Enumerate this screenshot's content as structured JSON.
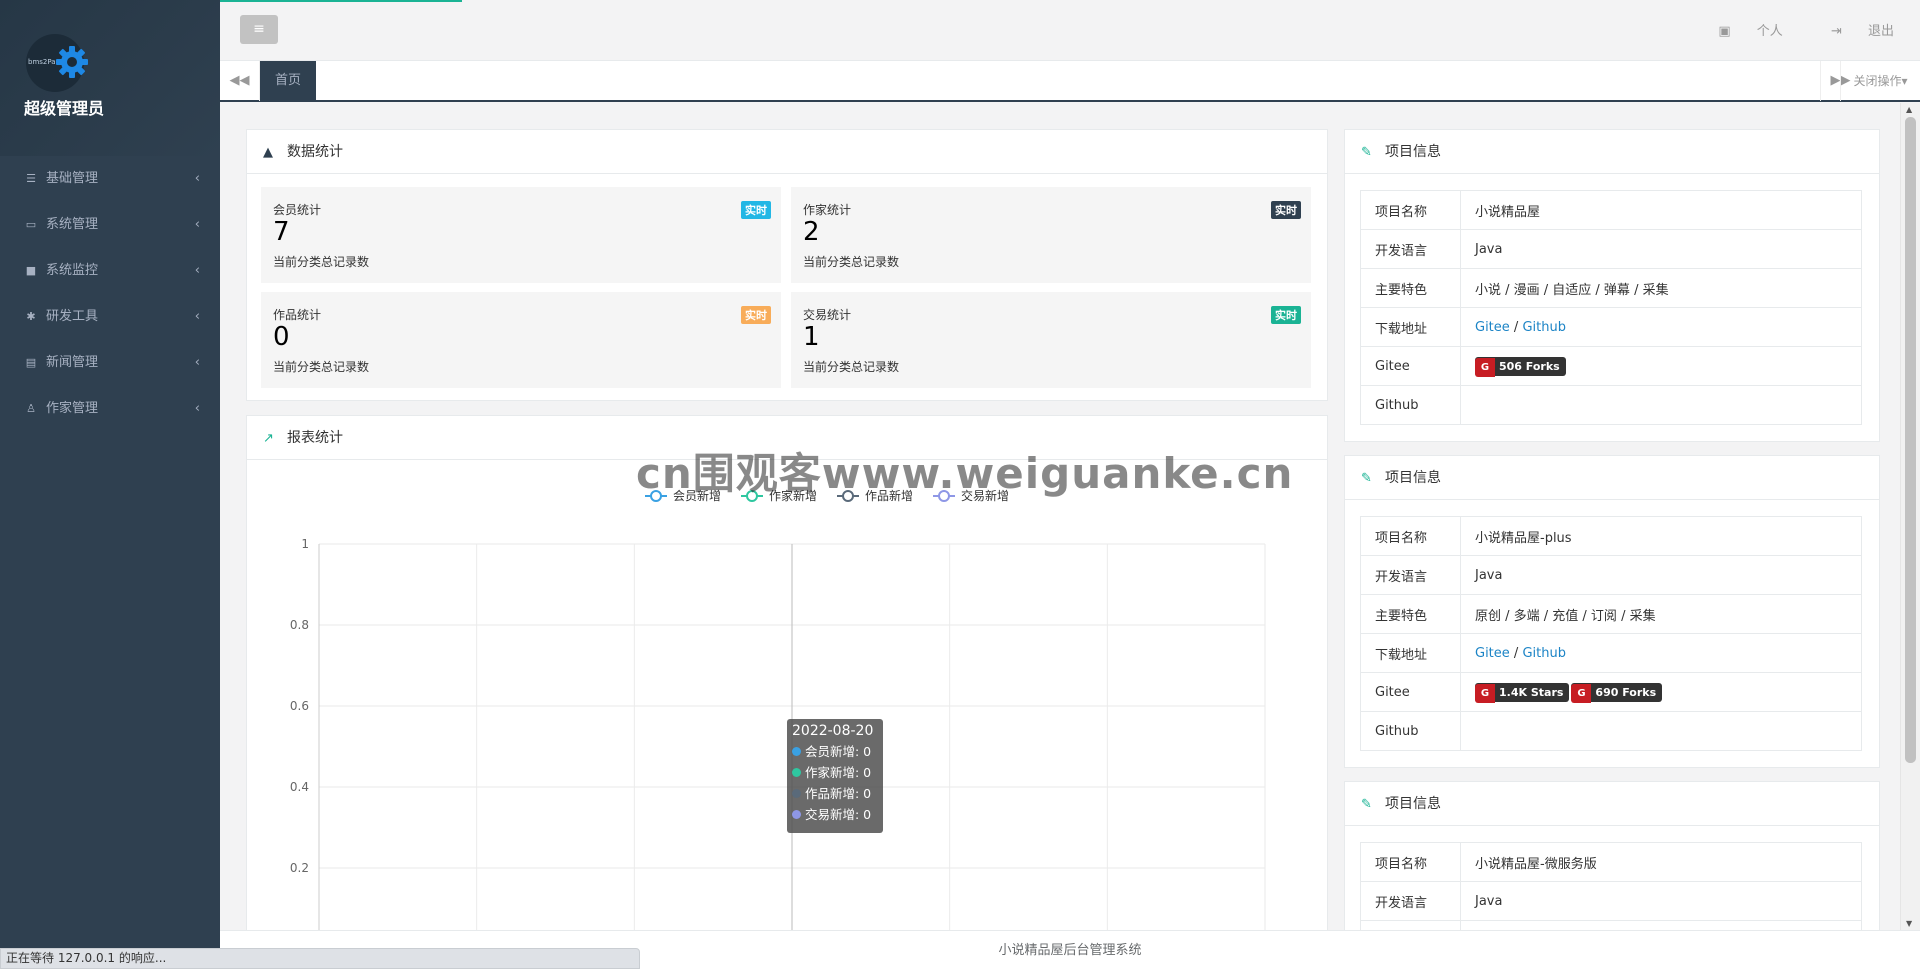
{
  "sidebar": {
    "user_name": "超级管理员",
    "avatar_text": "bms2Pa",
    "items": [
      {
        "label": "基础管理",
        "icon": "bars-icon"
      },
      {
        "label": "系统管理",
        "icon": "desktop-icon"
      },
      {
        "label": "系统监控",
        "icon": "video-icon"
      },
      {
        "label": "研发工具",
        "icon": "gear-icon"
      },
      {
        "label": "新闻管理",
        "icon": "newspaper-icon"
      },
      {
        "label": "作家管理",
        "icon": "user-icon"
      }
    ]
  },
  "header": {
    "menu_toggle_glyph": "≡",
    "personal_label": "个人",
    "logout_label": "退出"
  },
  "tabs": {
    "home_label": "首页",
    "close_op_label": "关闭操作"
  },
  "stats_panel": {
    "title": "数据统计",
    "cards": [
      {
        "label": "会员统计",
        "value": "7",
        "desc": "当前分类总记录数",
        "badge": "实时",
        "badge_color": "#23b7e5"
      },
      {
        "label": "作家统计",
        "value": "2",
        "desc": "当前分类总记录数",
        "badge": "实时",
        "badge_color": "#2f4050"
      },
      {
        "label": "作品统计",
        "value": "0",
        "desc": "当前分类总记录数",
        "badge": "实时",
        "badge_color": "#f8ac59"
      },
      {
        "label": "交易统计",
        "value": "1",
        "desc": "当前分类总记录数",
        "badge": "实时",
        "badge_color": "#1ab394"
      }
    ]
  },
  "report_panel": {
    "title": "报表统计"
  },
  "chart_data": {
    "type": "line",
    "x": [
      "2022-08-20"
    ],
    "series": [
      {
        "name": "会员新增",
        "values": [
          0
        ],
        "color": "#3aa1e3"
      },
      {
        "name": "作家新增",
        "values": [
          0
        ],
        "color": "#2ec7a0"
      },
      {
        "name": "作品新增",
        "values": [
          0
        ],
        "color": "#5a6a7a"
      },
      {
        "name": "交易新增",
        "values": [
          0
        ],
        "color": "#8e97e6"
      }
    ],
    "ylim": [
      0,
      1
    ],
    "yticks": [
      "1",
      "0.8",
      "0.6",
      "0.4",
      "0.2",
      "0"
    ],
    "grid": true,
    "legend": "top-center"
  },
  "tooltip": {
    "date": "2022-08-20",
    "rows": [
      {
        "text": "会员新增: 0",
        "color": "#3aa1e3"
      },
      {
        "text": "作家新增: 0",
        "color": "#2ec7a0"
      },
      {
        "text": "作品新增: 0",
        "color": "#5a6a7a"
      },
      {
        "text": "交易新增: 0",
        "color": "#8e97e6"
      }
    ]
  },
  "projects": [
    {
      "title": "项目信息",
      "rows": {
        "name_key": "项目名称",
        "name": "小说精品屋",
        "lang_key": "开发语言",
        "lang": "Java",
        "feat_key": "主要特色",
        "feat": "小说 / 漫画 / 自适应 / 弹幕 / 采集",
        "dl_key": "下载地址",
        "dl_gitee": "Gitee",
        "dl_sep": " / ",
        "dl_github": "Github",
        "gitee_key": "Gitee",
        "badge1": "506 Forks",
        "badge2": "",
        "github_key": "Github"
      }
    },
    {
      "title": "项目信息",
      "rows": {
        "name_key": "项目名称",
        "name": "小说精品屋-plus",
        "lang_key": "开发语言",
        "lang": "Java",
        "feat_key": "主要特色",
        "feat": "原创 / 多端 / 充值 / 订阅 / 采集",
        "dl_key": "下载地址",
        "dl_gitee": "Gitee",
        "dl_sep": " / ",
        "dl_github": "Github",
        "gitee_key": "Gitee",
        "badge1": "1.4K Stars",
        "badge2": "690 Forks",
        "github_key": "Github"
      }
    },
    {
      "title": "项目信息",
      "rows": {
        "name_key": "项目名称",
        "name": "小说精品屋-微服务版",
        "lang_key": "开发语言",
        "lang": "Java"
      }
    }
  ],
  "footer": {
    "text": "小说精品屋后台管理系统"
  },
  "status_bar": {
    "text": "正在等待 127.0.0.1 的响应..."
  },
  "watermark": {
    "text": "cn围观客www.weiguanke.cn"
  }
}
